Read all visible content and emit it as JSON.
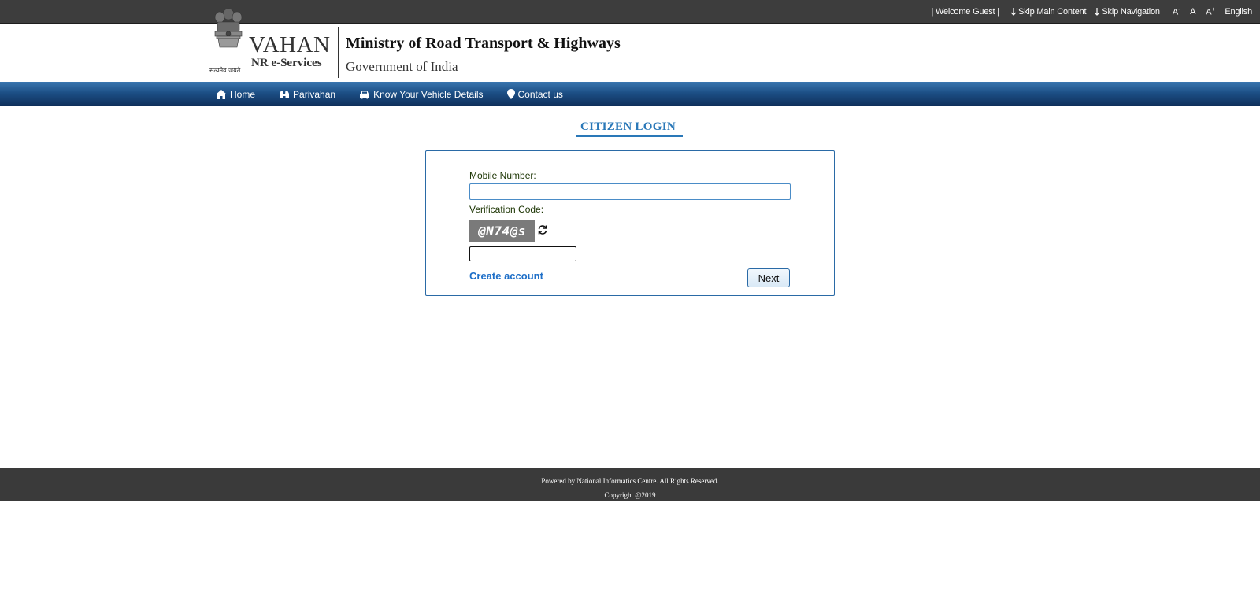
{
  "topbar": {
    "welcome": "| Welcome Guest |",
    "skip_main": "Skip Main Content",
    "skip_nav": "Skip Navigation",
    "font_decrease": "A",
    "font_decrease_sup": "-",
    "font_normal": "A",
    "font_increase": "A",
    "font_increase_sup": "+",
    "language": "English"
  },
  "header": {
    "emblem_caption": "सत्यमेव जयते",
    "brand_title": "VAHAN",
    "brand_subtitle": "NR e-Services",
    "ministry": "Ministry of Road Transport & Highways",
    "government": "Government of India"
  },
  "nav": {
    "items": [
      {
        "label": "Home",
        "icon": "home-icon"
      },
      {
        "label": "Parivahan",
        "icon": "binoculars-icon"
      },
      {
        "label": "Know Your Vehicle Details",
        "icon": "car-icon"
      },
      {
        "label": "Contact us",
        "icon": "map-marker-icon"
      }
    ]
  },
  "login": {
    "title": "CITIZEN LOGIN",
    "mobile_label": "Mobile Number:",
    "mobile_value": "",
    "verification_label": "Verification Code:",
    "captcha_text": "@N74@s",
    "captcha_value": "",
    "create_account": "Create account",
    "next_label": "Next"
  },
  "footer": {
    "powered_by": "Powered by National Informatics Centre. All Rights Reserved.",
    "copyright": "Copyright @2019"
  },
  "colors": {
    "accent": "#2a78b8",
    "topbar_bg": "#3d3d3d",
    "nav_bg": "#1c4f85",
    "footer_bg": "#3a3a3a",
    "link": "#1e6fc8"
  }
}
